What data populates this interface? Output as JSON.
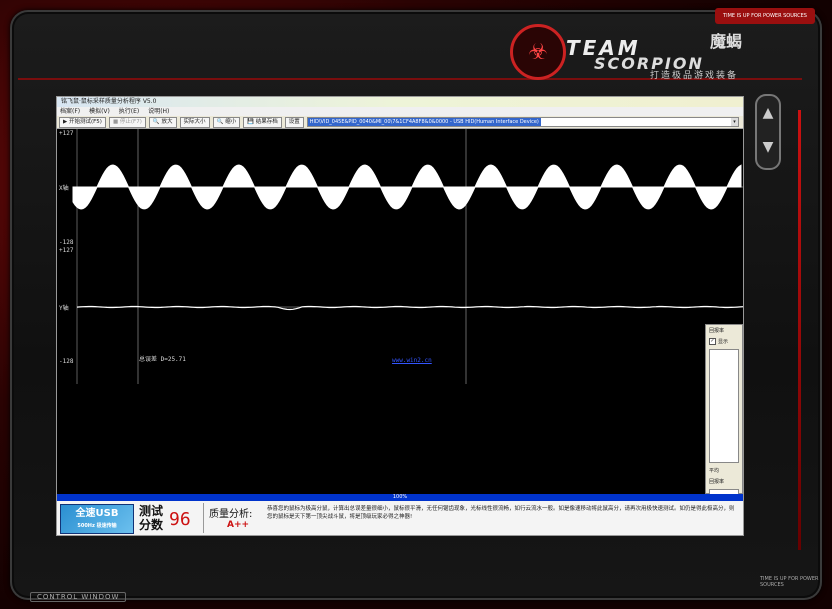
{
  "background": {
    "accent": "#c21111"
  },
  "top_strip": "TIME IS UP FOR POWER SOURCES",
  "logo": {
    "team": "TEAM",
    "scorpion": "SCORPION",
    "brand_cn": "魔蝎",
    "slogan": "打造极品游戏装备"
  },
  "side_nav": {
    "up": "▲",
    "down": "▼"
  },
  "control_window_label": "CONTROL WINDOW",
  "bottom_tag": "TIME IS UP FOR POWER SOURCES",
  "app": {
    "title": "铭飞鼠·鼠标采样质量分析程序 V5.0",
    "menu": [
      "档案(F)",
      "模拟(V)",
      "执行(E)",
      "说明(H)"
    ],
    "toolbar": {
      "start": "开始测试(F5)",
      "stop": "停止(F7)",
      "zoom_in": "放大",
      "actual": "实际大小",
      "zoom_out": "缩小",
      "save": "结果存档",
      "device_label": "设置",
      "device_value": "HID\\VID_045E&PID_0040&MI_00\\7&1CF4A8F8&0&0000 - USB HID(Human Interface Device)"
    },
    "plot": {
      "x_axis_label": "X轴",
      "y_axis_label": "Y轴",
      "top_max": "+127",
      "top_min": "-128",
      "bottom_max": "+127",
      "bottom_min": "-128",
      "total_error": "总误差 D=25.71",
      "watermark": "www.win2.cn"
    },
    "right_panel": {
      "title": "回报率",
      "show_label": "显示",
      "show_checked": true,
      "avg_label": "平均",
      "rate_label": "回报率"
    },
    "progress_text": "100%",
    "progress_value": 100,
    "bottom": {
      "usb_logo": "全速USB",
      "usb_sub": "500Hz 极速传输",
      "score_label_1": "测试",
      "score_label_2": "分数",
      "score": "96",
      "analysis_label": "质量分析",
      "grade": "A++",
      "analysis_text": "恭喜您的鼠标为极高分鼠，计算出总误差量很细小，鼠标很平滑，无任何锯齿现象，光标线性很流畅，如行云流水一般。如是像速移动将此鼠高分，请再次用极快速测试。如仍是得此极高分，则您的鼠标是天下第一顶尖战斗鼠，将是顶级玩家必得之神器!"
    }
  }
}
